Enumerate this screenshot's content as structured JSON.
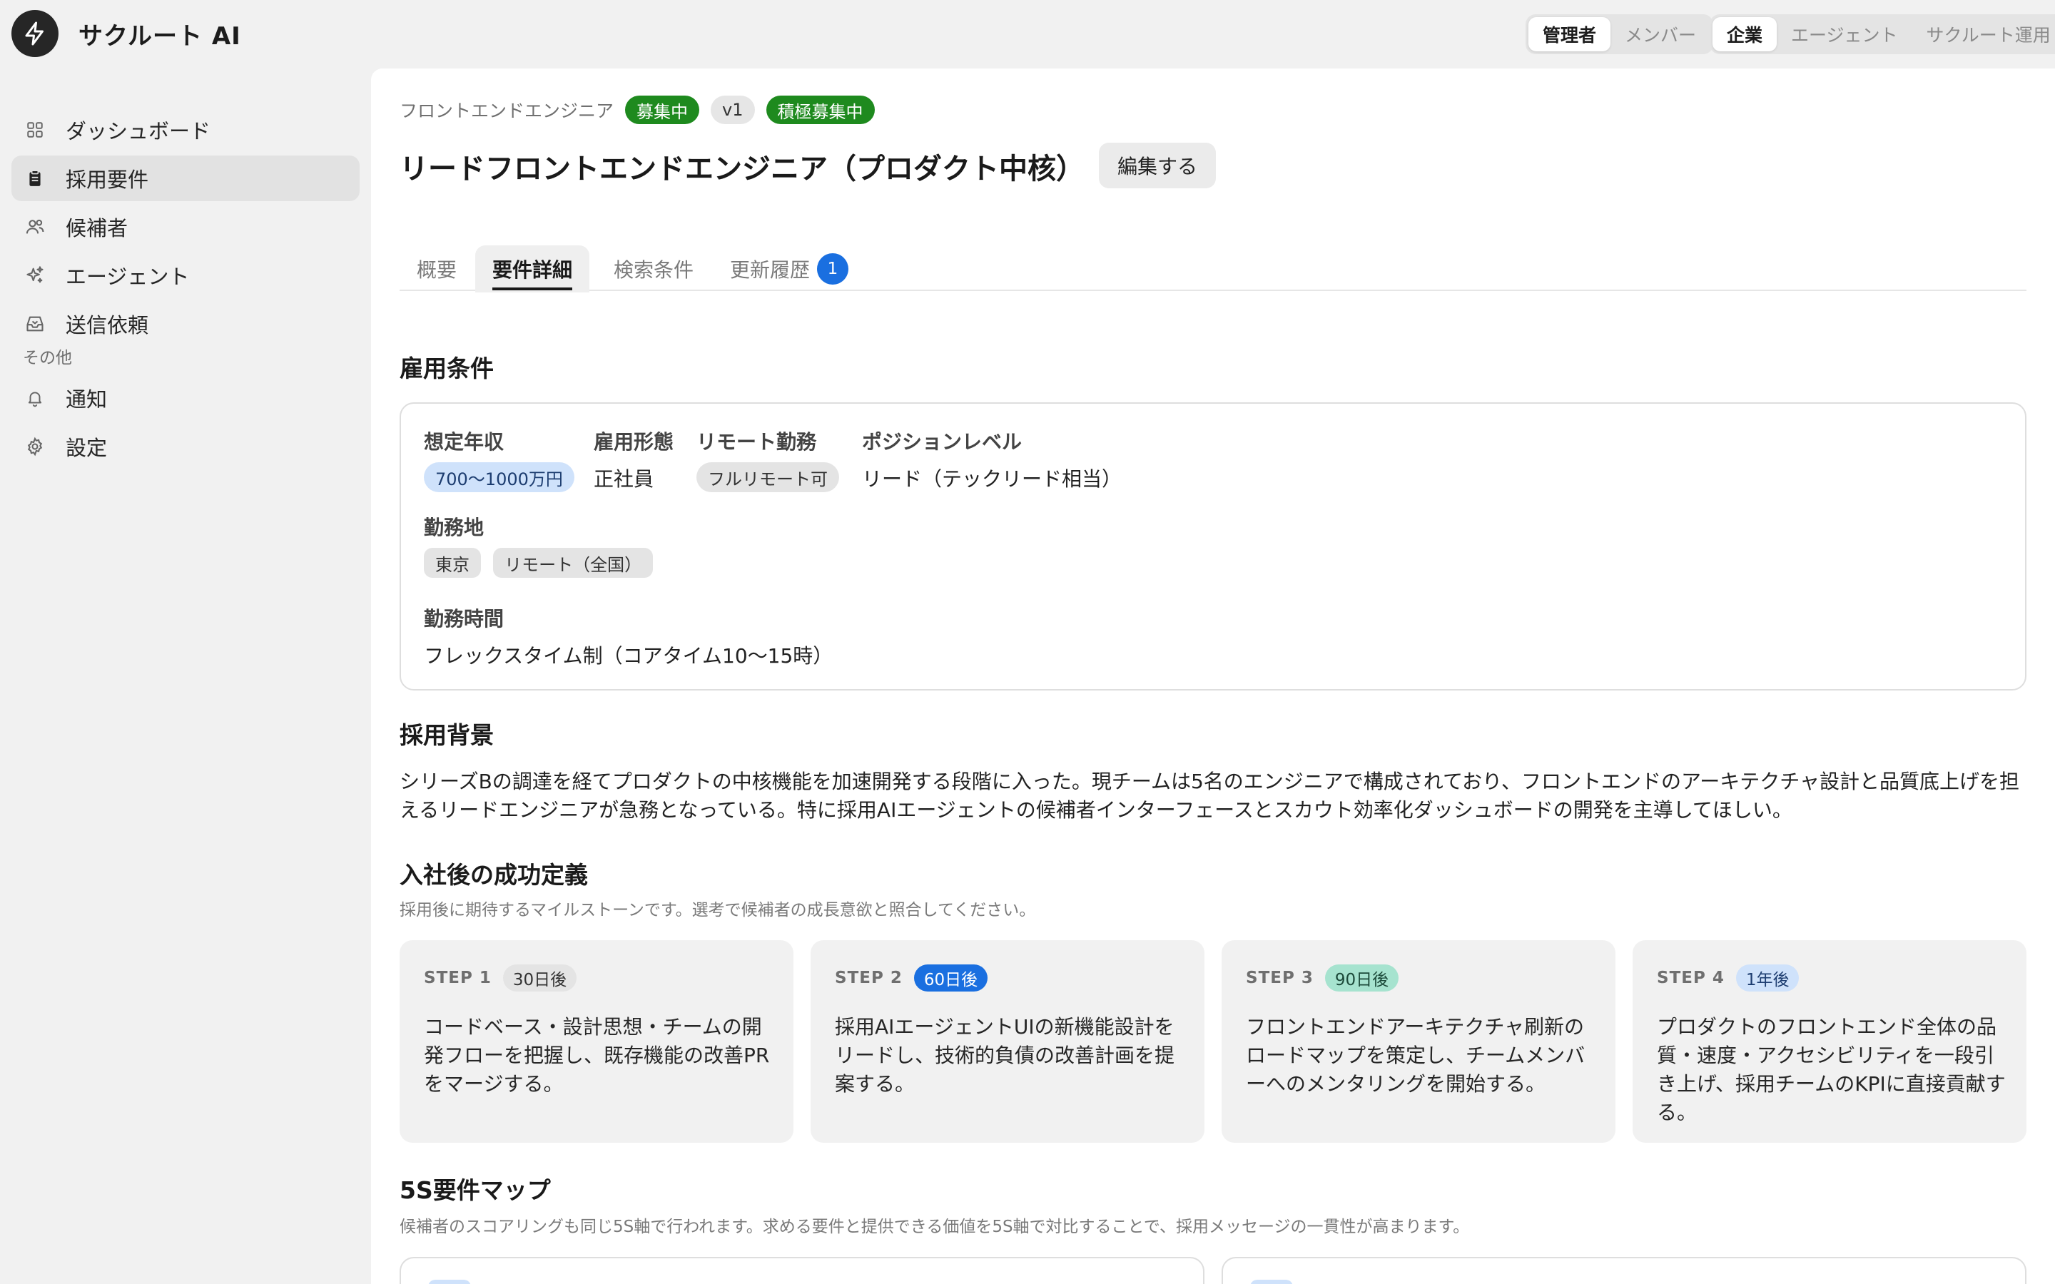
{
  "app": {
    "name": "サクルート AI"
  },
  "header": {
    "role_switch": [
      {
        "label": "管理者",
        "active": true
      },
      {
        "label": "メンバー",
        "active": false
      }
    ],
    "view_switch": [
      {
        "label": "企業",
        "active": true
      },
      {
        "label": "エージェント",
        "active": false
      },
      {
        "label": "サクルート運用",
        "active": false
      }
    ]
  },
  "sidebar": {
    "items": [
      {
        "label": "ダッシュボード",
        "icon": "dashboard-grid-icon",
        "active": false
      },
      {
        "label": "採用要件",
        "icon": "clipboard-icon",
        "active": true
      },
      {
        "label": "候補者",
        "icon": "users-icon",
        "active": false
      },
      {
        "label": "エージェント",
        "icon": "sparkle-icon",
        "active": false
      },
      {
        "label": "送信依頼",
        "icon": "inbox-icon",
        "active": false
      }
    ],
    "section_label": "その他",
    "other_items": [
      {
        "label": "通知",
        "icon": "bell-icon"
      },
      {
        "label": "設定",
        "icon": "gear-icon"
      }
    ]
  },
  "page": {
    "breadcrumb": "フロントエンドエンジニア",
    "badges": {
      "status": "募集中",
      "version": "v1",
      "priority": "積極募集中"
    },
    "title": "リードフロントエンドエンジニア（プロダクト中核）",
    "edit_label": "編集する",
    "tabs": [
      {
        "label": "概要"
      },
      {
        "label": "要件詳細",
        "active": true
      },
      {
        "label": "検索条件"
      },
      {
        "label": "更新履歴",
        "count": "1"
      }
    ]
  },
  "employment": {
    "heading": "雇用条件",
    "salary_label": "想定年収",
    "salary_value": "700〜1000万円",
    "type_label": "雇用形態",
    "type_value": "正社員",
    "remote_label": "リモート勤務",
    "remote_value": "フルリモート可",
    "level_label": "ポジションレベル",
    "level_value": "リード（テックリード相当）",
    "location_label": "勤務地",
    "locations": [
      "東京",
      "リモート（全国）"
    ],
    "hours_label": "勤務時間",
    "hours_value": "フレックスタイム制（コアタイム10〜15時）"
  },
  "background": {
    "heading": "採用背景",
    "text": "シリーズBの調達を経てプロダクトの中核機能を加速開発する段階に入った。現チームは5名のエンジニアで構成されており、フロントエンドのアーキテクチャ設計と品質底上げを担えるリードエンジニアが急務となっている。特に採用AIエージェントの候補者インターフェースとスカウト効率化ダッシュボードの開発を主導してほしい。"
  },
  "success": {
    "heading": "入社後の成功定義",
    "subtitle": "採用後に期待するマイルストーンです。選考で候補者の成長意欲と照合してください。",
    "steps": [
      {
        "step": "STEP 1",
        "badge": "30日後",
        "badge_bg": "#e4e4e4",
        "badge_fg": "#333333",
        "text": "コードベース・設計思想・チームの開発フローを把握し、既存機能の改善PRをマージする。"
      },
      {
        "step": "STEP 2",
        "badge": "60日後",
        "badge_bg": "#1a6fe0",
        "badge_fg": "#ffffff",
        "text": "採用AIエージェントUIの新機能設計をリードし、技術的負債の改善計画を提案する。"
      },
      {
        "step": "STEP 3",
        "badge": "90日後",
        "badge_bg": "#a6e3cf",
        "badge_fg": "#1c4a3a",
        "text": "フロントエンドアーキテクチャ刷新のロードマップを策定し、チームメンバーへのメンタリングを開始する。"
      },
      {
        "step": "STEP 4",
        "badge": "1年後",
        "badge_bg": "#cfe2fb",
        "badge_fg": "#1d3d70",
        "text": "プロダクトのフロントエンド全体の品質・速度・アクセシビリティを一段引き上げ、採用チームのKPIに直接貢献する。"
      }
    ]
  },
  "map": {
    "heading": "5S要件マップ",
    "subtitle": "候補者のスコアリングも同じ5S軸で行われます。求める要件と提供できる価値を5S軸で対比することで、採用メッセージの一貫性が高まります。"
  },
  "colors": {
    "accent_green": "#1e8a1e",
    "accent_blue": "#1a6fe0",
    "sidebar_bg": "#f1f1f1",
    "main_bg": "#ffffff"
  }
}
